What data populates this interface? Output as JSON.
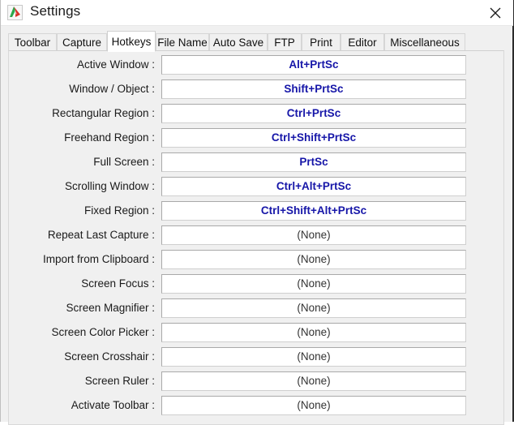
{
  "window": {
    "title": "Settings",
    "app_icon": "picpick-logo-icon",
    "close_label": "✕"
  },
  "tabs": {
    "items": [
      {
        "label": "Toolbar",
        "active": false
      },
      {
        "label": "Capture",
        "active": false
      },
      {
        "label": "Hotkeys",
        "active": true
      },
      {
        "label": "File Name",
        "active": false
      },
      {
        "label": "Auto Save",
        "active": false
      },
      {
        "label": "FTP",
        "active": false
      },
      {
        "label": "Print",
        "active": false
      },
      {
        "label": "Editor",
        "active": false
      },
      {
        "label": "Miscellaneous",
        "active": false
      }
    ]
  },
  "hotkeys": {
    "assigned_color": "#1616a8",
    "none_value": "(None)",
    "rows": [
      {
        "name": "active-window",
        "label": "Active Window :",
        "value": "Alt+PrtSc",
        "assigned": true
      },
      {
        "name": "window-object",
        "label": "Window / Object :",
        "value": "Shift+PrtSc",
        "assigned": true
      },
      {
        "name": "rectangular-region",
        "label": "Rectangular Region :",
        "value": "Ctrl+PrtSc",
        "assigned": true
      },
      {
        "name": "freehand-region",
        "label": "Freehand Region :",
        "value": "Ctrl+Shift+PrtSc",
        "assigned": true
      },
      {
        "name": "full-screen",
        "label": "Full Screen :",
        "value": "PrtSc",
        "assigned": true
      },
      {
        "name": "scrolling-window",
        "label": "Scrolling Window :",
        "value": "Ctrl+Alt+PrtSc",
        "assigned": true
      },
      {
        "name": "fixed-region",
        "label": "Fixed Region :",
        "value": "Ctrl+Shift+Alt+PrtSc",
        "assigned": true
      },
      {
        "name": "repeat-last-capture",
        "label": "Repeat Last Capture :",
        "value": "(None)",
        "assigned": false
      },
      {
        "name": "import-from-clipboard",
        "label": "Import from Clipboard :",
        "value": "(None)",
        "assigned": false
      },
      {
        "name": "screen-focus",
        "label": "Screen Focus :",
        "value": "(None)",
        "assigned": false
      },
      {
        "name": "screen-magnifier",
        "label": "Screen Magnifier :",
        "value": "(None)",
        "assigned": false
      },
      {
        "name": "screen-color-picker",
        "label": "Screen Color Picker :",
        "value": "(None)",
        "assigned": false
      },
      {
        "name": "screen-crosshair",
        "label": "Screen Crosshair :",
        "value": "(None)",
        "assigned": false
      },
      {
        "name": "screen-ruler",
        "label": "Screen Ruler :",
        "value": "(None)",
        "assigned": false
      },
      {
        "name": "activate-toolbar",
        "label": "Activate Toolbar :",
        "value": "(None)",
        "assigned": false
      }
    ]
  }
}
